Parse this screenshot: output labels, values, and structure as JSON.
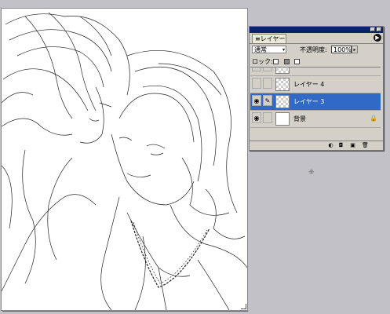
{
  "layers_panel": {
    "tab_label": "≡レイヤー",
    "blend_mode": "通常",
    "opacity_label": "不透明度:",
    "opacity_value": "100%",
    "lock_label": "ロック:",
    "layers": [
      {
        "name": "",
        "visible": false,
        "thumb": "transparent"
      },
      {
        "name": "レイヤー 4",
        "visible": false,
        "thumb": "transparent"
      },
      {
        "name": "レイヤー 3",
        "visible": true,
        "thumb": "transparent",
        "selected": true
      },
      {
        "name": "背景",
        "visible": true,
        "thumb": "white",
        "locked": true
      }
    ]
  },
  "colors": {
    "workspace": "#c2c1c7",
    "title_bar": "#0a246a",
    "selection": "#3169c6",
    "panel": "#d4d0c8"
  },
  "icons": [
    "eye-icon",
    "brush-icon",
    "lock-icon",
    "layer-style-icon",
    "mask-icon",
    "new-layer-icon",
    "trash-icon",
    "palette-menu-icon"
  ]
}
